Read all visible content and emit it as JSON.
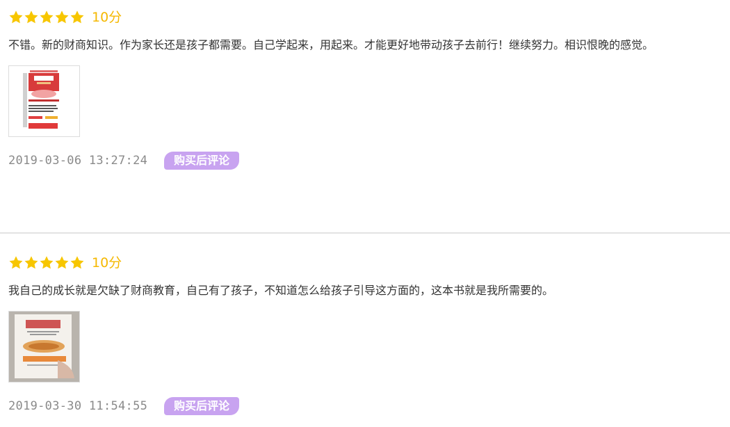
{
  "colors": {
    "star": "#f7c600",
    "score": "#f5b800",
    "badge_bg": "#c8a3f0",
    "text": "#333333",
    "timestamp": "#8a8a8a",
    "divider": "#e3e3e3"
  },
  "reviews": [
    {
      "stars": 5,
      "score": "10分",
      "text": "不错。新的财商知识。作为家长还是孩子都需要。自己学起来，用起来。才能更好地带动孩子去前行！继续努力。相识恨晚的感觉。",
      "image_icon": "book-cover-thumbnail",
      "timestamp": "2019-03-06 13:27:24",
      "badge": "购买后评论"
    },
    {
      "stars": 5,
      "score": "10分",
      "text": "我自己的成长就是欠缺了财商教育，自己有了孩子，不知道怎么给孩子引导这方面的，这本书就是我所需要的。",
      "image_icon": "book-photo-thumbnail",
      "timestamp": "2019-03-30 11:54:55",
      "badge": "购买后评论"
    }
  ]
}
